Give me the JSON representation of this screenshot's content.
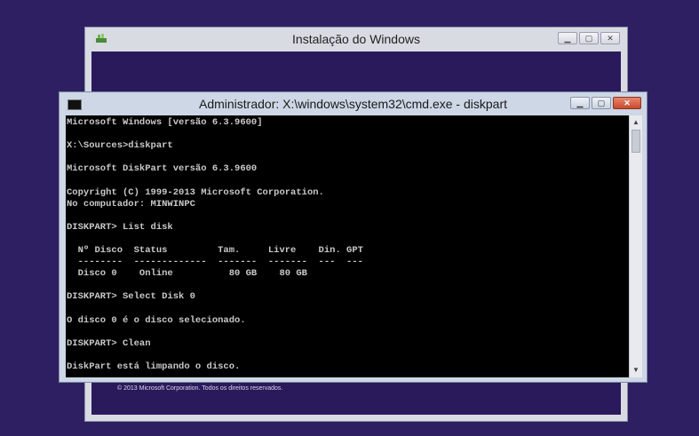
{
  "setup_window": {
    "title": "Instalação do Windows",
    "copyright": "© 2013 Microsoft Corporation. Todos os direitos reservados."
  },
  "cmd_window": {
    "title": "Administrador: X:\\windows\\system32\\cmd.exe - diskpart",
    "console_text": "Microsoft Windows [versão 6.3.9600]\n\nX:\\Sources>diskpart\n\nMicrosoft DiskPart versão 6.3.9600\n\nCopyright (C) 1999-2013 Microsoft Corporation.\nNo computador: MINWINPC\n\nDISKPART> List disk\n\n  Nº Disco  Status         Tam.     Livre    Din. GPT\n  --------  -------------  -------  -------  ---  ---\n  Disco 0    Online          80 GB    80 GB\n\nDISKPART> Select Disk 0\n\nO disco 0 é o disco selecionado.\n\nDISKPART> Clean\n\nDiskPart está limpando o disco.\n\nDISKPART> Convert GPT"
  },
  "icons": {
    "setup_icon": "windows-setup-icon",
    "cmd_icon": "console-icon",
    "minimize": "minimize-icon",
    "maximize": "maximize-icon",
    "close": "close-icon",
    "scroll_up": "scroll-up-arrow-icon",
    "scroll_down": "scroll-down-arrow-icon"
  },
  "colors": {
    "desktop": "#2e1f63",
    "close_button": "#c84a2c",
    "console_bg": "#000000",
    "console_fg": "#c8c8c8"
  }
}
